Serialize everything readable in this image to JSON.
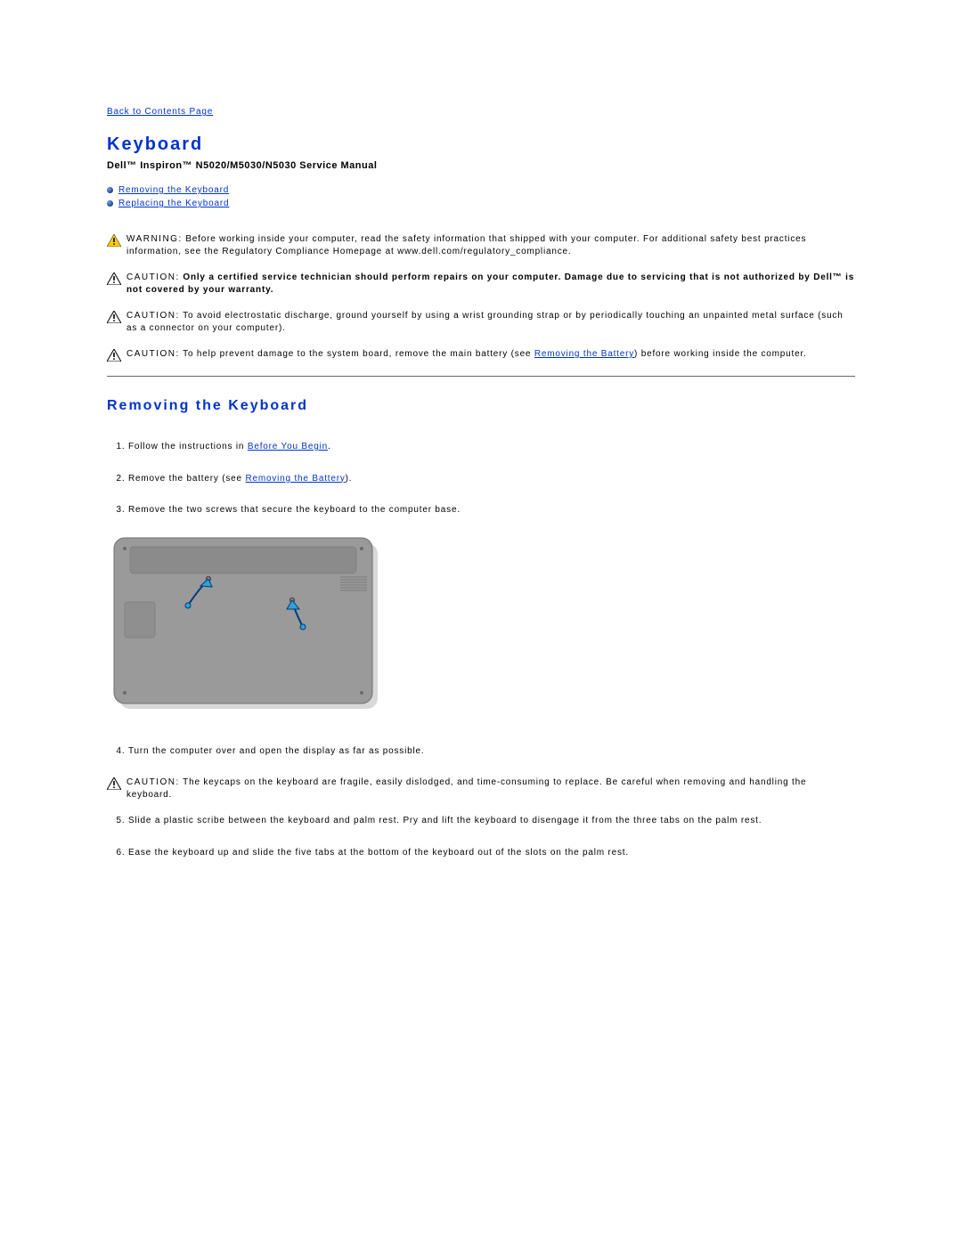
{
  "backLink": "Back to Contents Page",
  "title": "Keyboard",
  "subtitle": "Dell™ Inspiron™ N5020/M5030/N5030 Service Manual",
  "toc": [
    "Removing the Keyboard",
    "Replacing the Keyboard"
  ],
  "notices": {
    "warning": {
      "label": "WARNING:",
      "text": " Before working inside your computer, read the safety information that shipped with your computer. For additional safety best practices information, see the Regulatory Compliance Homepage at www.dell.com/regulatory_compliance."
    },
    "caution_service": {
      "label": "CAUTION:",
      "text": " Only a certified service technician should perform repairs on your computer. Damage due to servicing that is not authorized by Dell™ is not covered by your warranty."
    },
    "caution_esd": {
      "label": "CAUTION:",
      "text": " To avoid electrostatic discharge, ground yourself by using a wrist grounding strap or by periodically touching an unpainted metal surface (such as a connector on your computer)."
    },
    "caution_battery": {
      "label": "CAUTION:",
      "text_before": " To help prevent damage to the system board, remove the main battery (see ",
      "link": "Removing the Battery",
      "text_after": ") before working inside the computer."
    },
    "caution_keycaps": {
      "label": "CAUTION:",
      "text": " The keycaps on the keyboard are fragile, easily dislodged, and time-consuming to replace. Be careful when removing and handling the keyboard."
    }
  },
  "section_title": "Removing the Keyboard",
  "steps": {
    "s1_prefix": "Follow the instructions in ",
    "s1_link": "Before You Begin",
    "s1_suffix": ".",
    "s2_prefix": "Remove the battery (see ",
    "s2_link": "Removing the Battery",
    "s2_suffix": ").",
    "s3": "Remove the two screws that secure the keyboard to the computer base.",
    "s4": "Turn the computer over and open the display as far as possible.",
    "s5": "Slide a plastic scribe between the keyboard and palm rest. Pry and lift the keyboard to disengage it from the three tabs on the palm rest.",
    "s6": "Ease the keyboard up and slide the five tabs at the bottom of the keyboard out of the slots on the palm rest."
  }
}
